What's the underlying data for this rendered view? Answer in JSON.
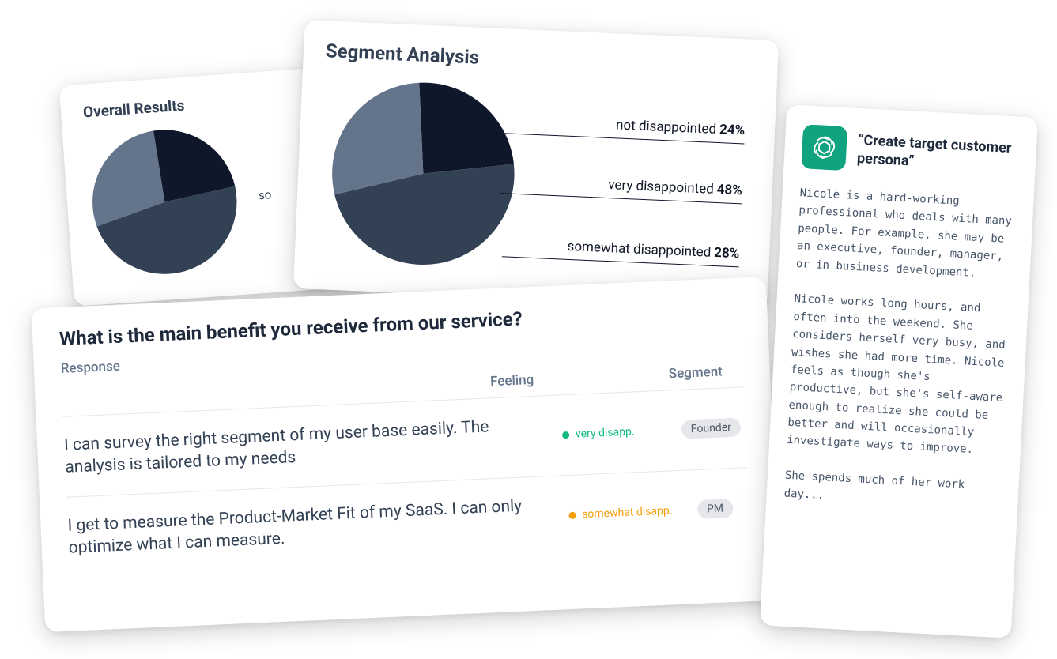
{
  "chart_data": [
    {
      "id": "overall",
      "type": "pie",
      "title": "Overall Results",
      "slices": [
        {
          "label": "not disappointed",
          "value": 24,
          "color": "#0f172a"
        },
        {
          "label": "very disappointed",
          "value": 48,
          "color": "#334155"
        },
        {
          "label": "somewhat disappointed",
          "value": 28,
          "color": "#64748b"
        }
      ]
    },
    {
      "id": "segment",
      "type": "pie",
      "title": "Segment Analysis",
      "slices": [
        {
          "label": "not disappointed",
          "value": 24,
          "color": "#0f172a"
        },
        {
          "label": "very disappointed",
          "value": 48,
          "color": "#334155"
        },
        {
          "label": "somewhat disappointed",
          "value": 28,
          "color": "#64748b"
        }
      ]
    }
  ],
  "overall": {
    "title": "Overall Results",
    "partial_label": "so"
  },
  "segment": {
    "title": "Segment Analysis",
    "labels": {
      "not": {
        "text": "not disappointed",
        "pct": "24%"
      },
      "very": {
        "text": "very disappointed",
        "pct": "48%"
      },
      "somewhat": {
        "text": "somewhat disappointed",
        "pct": "28%"
      }
    }
  },
  "responses": {
    "question": "What is the main benefit you receive from our service?",
    "headers": {
      "response": "Response",
      "feeling": "Feeling",
      "segment": "Segment"
    },
    "rows": [
      {
        "text": "I can survey the right segment of my user base easily. The analysis is tailored to my needs",
        "feeling": "very disapp.",
        "feeling_color": "green",
        "segment": "Founder"
      },
      {
        "text": "I get to measure the Product-Market Fit of my SaaS. I can only optimize what I can measure.",
        "feeling": "somewhat disapp.",
        "feeling_color": "orange",
        "segment": "PM"
      }
    ]
  },
  "persona": {
    "title": "“Create target customer persona”",
    "body": "Nicole is a hard-working professional who deals with many people. For example, she may be an executive, founder, manager, or in business development.\n\nNicole works long hours, and often into the weekend. She considers herself very busy, and wishes she had more time. Nicole feels as though she's productive, but she's self-aware enough to realize she could be better and will occasionally investigate ways to improve.\n\nShe spends much of her work day..."
  },
  "colors": {
    "slice_dark": "#0f172a",
    "slice_mid": "#334155",
    "slice_light": "#64748b",
    "accent_green": "#10b981",
    "accent_orange": "#f59e0b",
    "openai_green": "#10a37f"
  }
}
